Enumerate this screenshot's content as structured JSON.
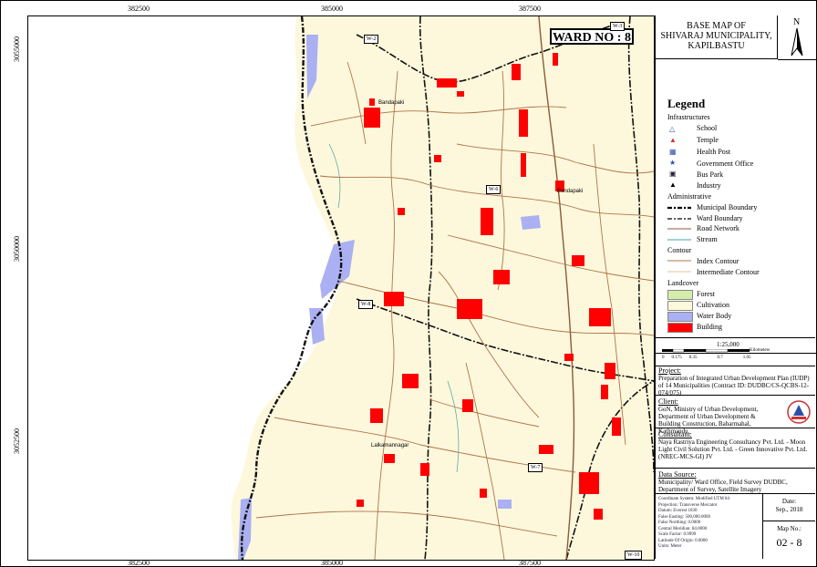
{
  "map": {
    "x_ticks": [
      "382500",
      "385000",
      "387500"
    ],
    "y_ticks": [
      "3055000",
      "3052500",
      "3050000"
    ],
    "ward_label": "WARD NO : 8",
    "ward_boxes": [
      "W-2",
      "W-3",
      "W-6",
      "W-8",
      "W-7",
      "W-10"
    ],
    "places": [
      "Bandapaki",
      "Lalkamannagar",
      "Bandapaki"
    ]
  },
  "title": {
    "line1": "BASE MAP OF",
    "line2": "SHIVARAJ MUNICIPALITY,",
    "line3": "KAPILBASTU",
    "north": "N"
  },
  "legend": {
    "title": "Legend",
    "infra_heading": "Infrastructures",
    "infra": [
      "School",
      "Temple",
      "Health Post",
      "Government Office",
      "Bus Park",
      "Industry"
    ],
    "admin_heading": "Administrative",
    "admin": [
      "Municipal Boundary",
      "Ward Boundary",
      "Road Network",
      "Stream"
    ],
    "contour_heading": "Contour",
    "contour": [
      "Index Contour",
      "Intermediate Contour"
    ],
    "landcover_heading": "Landcover",
    "landcover": [
      "Forest",
      "Cultivation",
      "Water Body",
      "Building"
    ],
    "colors": {
      "forest": "#d4eeaa",
      "cultivation": "#fdf8dc",
      "water": "#aab0f2",
      "building": "#ff0000"
    }
  },
  "scale": {
    "ratio": "1:25,000",
    "unit": "Kilometers",
    "labels": [
      "0",
      "0.175",
      "0.35",
      "0.7",
      "1.05"
    ]
  },
  "project": {
    "heading": "Project:",
    "text": "Preparation of Integrated Urban Development Plan (IUDP) of 14 Municipalities (Contract ID: DUDBC/CS-QCBS-12-074/075)"
  },
  "client": {
    "heading": "Client:",
    "text": "GoN, Ministry of Urban Development, Department of Urban Development & Building Construction, Babarmahal, Kathmandu"
  },
  "consultant": {
    "heading": "Consultant:",
    "text": "Naya Rastriya Engineering Consultancy Pvt. Ltd. - Moon Light Civil Solution Pvt. Ltd. - Green Innovative Pvt. Ltd. (NREC-MCS-GI) JV"
  },
  "data_source": {
    "heading": "Data Source:",
    "text": "Municipality/ Ward Office, Field Survey DUDBC, Department of Survey, Satellite Imagery"
  },
  "coord": {
    "lines": [
      "Coordinate System: Modified UTM 84",
      "Projection: Transverse Mercator",
      "Datum: Everest 1830",
      "False Easting: 500,000.0000",
      "False Northing: 0.0000",
      "Central Meridian: 84.0000",
      "Scale Factor: 0.9999",
      "Latitude Of Origin: 0.0000",
      "Units: Meter"
    ],
    "date_label": "Date:",
    "date": "Sep., 2018",
    "mapno_label": "Map No.:",
    "mapno": "02 - 8"
  }
}
